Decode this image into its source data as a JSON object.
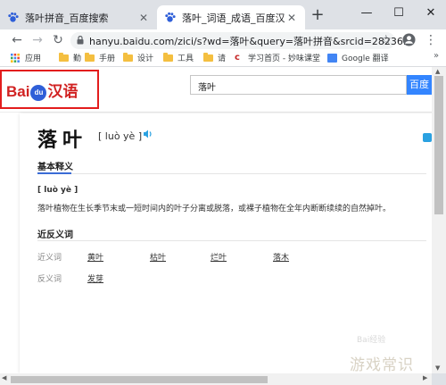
{
  "tabs": [
    {
      "label": "落叶拼音_百度搜索",
      "active": false
    },
    {
      "label": "落叶_词语_成语_百度汉语",
      "active": true
    }
  ],
  "toolbar": {
    "url": "hanyu.baidu.com/zici/s?wd=落叶&query=落叶拼音&srcid=28236..."
  },
  "bookmarks": [
    {
      "label": "应用",
      "icon": "apps-grid-icon"
    },
    {
      "label": "勤",
      "icon": "folder-icon"
    },
    {
      "label": "手册",
      "icon": "folder-icon"
    },
    {
      "label": "设计",
      "icon": "folder-icon"
    },
    {
      "label": "工具",
      "icon": "folder-icon"
    },
    {
      "label": "请",
      "icon": "folder-icon"
    },
    {
      "label": "学习首页 - 妙味课堂",
      "icon": "miaov-icon"
    },
    {
      "label": "Google 翻译",
      "icon": "google-translate-icon"
    }
  ],
  "header": {
    "logo_left": "Bai",
    "logo_paw": "du",
    "logo_right": "汉语",
    "search_value": "落叶",
    "search_button": "百度"
  },
  "entry": {
    "word": "落叶",
    "pinyin": "[ luò yè ]",
    "tab_basic": "基本释义",
    "def_pinyin": "[ luò yè ]",
    "definition": "落叶植物在生长季节末或一短时间内的叶子分离或脱落，或裸子植物在全年内断断续续的自然掉叶。",
    "syn_title": "近反义词",
    "synonyms_label": "近义词",
    "synonyms": [
      "黄叶",
      "枯叶",
      "烂叶",
      "落木"
    ],
    "antonyms_label": "反义词",
    "antonyms": [
      "发芽"
    ]
  },
  "watermark": {
    "text": "游戏常识",
    "small": "Bai经验"
  },
  "colors": {
    "accent": "#3385ff",
    "logo_red": "#d12222",
    "highlight_box": "#e31d1d",
    "folder": "#f4bf40"
  }
}
